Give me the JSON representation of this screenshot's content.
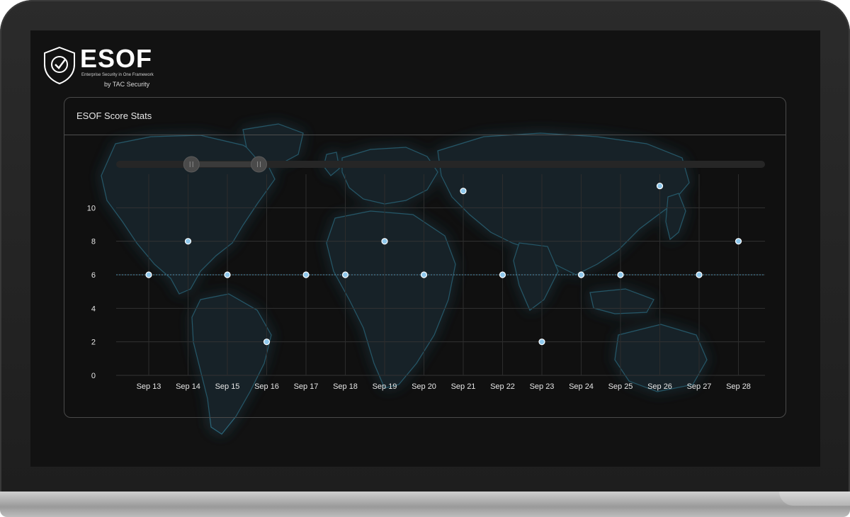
{
  "brand": {
    "name": "ESOF",
    "tagline": "Enterprise Security in One Framework",
    "byline": "by TAC Security",
    "accent": "#5fb3e6"
  },
  "card": {
    "title": "ESOF Score Stats"
  },
  "range_slider": {
    "start": 0.116,
    "end": 0.22
  },
  "chart_data": {
    "type": "scatter",
    "title": "ESOF Score Stats",
    "xlabel": "",
    "ylabel": "",
    "categories": [
      "Sep 13",
      "Sep 14",
      "Sep 15",
      "Sep 16",
      "Sep 17",
      "Sep 18",
      "Sep 19",
      "Sep 20",
      "Sep 21",
      "Sep 22",
      "Sep 23",
      "Sep 24",
      "Sep 25",
      "Sep 26",
      "Sep 27",
      "Sep 28"
    ],
    "values": [
      6,
      8,
      6,
      2,
      6,
      6,
      8,
      6,
      11,
      6,
      2,
      6,
      6,
      11.3,
      6,
      8
    ],
    "yticks": [
      0,
      2,
      4,
      6,
      8,
      10
    ],
    "ylim": [
      0,
      12
    ],
    "reference_line": 6,
    "grid": true,
    "point_color": "#8fc8ec"
  }
}
